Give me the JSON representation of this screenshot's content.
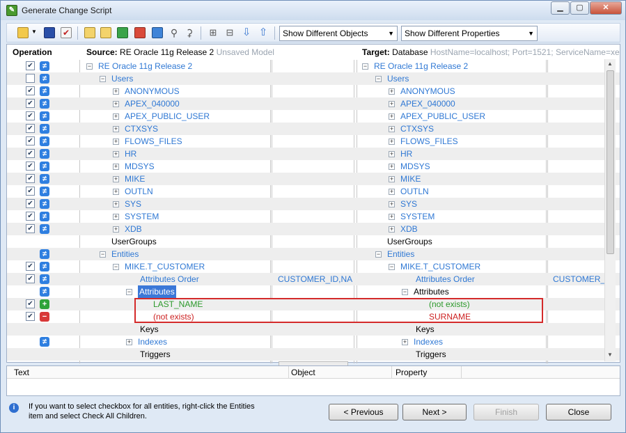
{
  "window": {
    "title": "Generate Change Script",
    "controls": [
      "▁",
      "▢",
      "✕"
    ]
  },
  "toolbar": {
    "filter_objects": "Show Different Objects",
    "filter_properties": "Show Different Properties"
  },
  "headers": {
    "operation": "Operation",
    "source_label": "Source:",
    "source_name": "RE Oracle 11g Release 2",
    "source_note": "Unsaved Model",
    "target_label": "Target:",
    "target_name": "Database",
    "target_note": "HostName=localhost; Port=1521; ServiceName=xe; UserId"
  },
  "rows": [
    {
      "check": true,
      "op": "ne",
      "src": "RE Oracle 11g Release 2",
      "tgt": "RE Oracle 11g Release 2",
      "level": 0,
      "exp": "−",
      "src_color": "blue",
      "tgt_color": "blue",
      "src_val": "",
      "tgt_val": ""
    },
    {
      "check": false,
      "op": "ne",
      "src": "Users",
      "tgt": "Users",
      "level": 1,
      "exp": "−",
      "src_color": "blue",
      "tgt_color": "blue",
      "src_val": "",
      "tgt_val": ""
    },
    {
      "check": true,
      "op": "ne",
      "src": "ANONYMOUS",
      "tgt": "ANONYMOUS",
      "level": 2,
      "exp": "+",
      "src_color": "blue",
      "tgt_color": "blue",
      "src_val": "",
      "tgt_val": ""
    },
    {
      "check": true,
      "op": "ne",
      "src": "APEX_040000",
      "tgt": "APEX_040000",
      "level": 2,
      "exp": "+",
      "src_color": "blue",
      "tgt_color": "blue",
      "src_val": "",
      "tgt_val": ""
    },
    {
      "check": true,
      "op": "ne",
      "src": "APEX_PUBLIC_USER",
      "tgt": "APEX_PUBLIC_USER",
      "level": 2,
      "exp": "+",
      "src_color": "blue",
      "tgt_color": "blue",
      "src_val": "",
      "tgt_val": ""
    },
    {
      "check": true,
      "op": "ne",
      "src": "CTXSYS",
      "tgt": "CTXSYS",
      "level": 2,
      "exp": "+",
      "src_color": "blue",
      "tgt_color": "blue",
      "src_val": "",
      "tgt_val": ""
    },
    {
      "check": true,
      "op": "ne",
      "src": "FLOWS_FILES",
      "tgt": "FLOWS_FILES",
      "level": 2,
      "exp": "+",
      "src_color": "blue",
      "tgt_color": "blue",
      "src_val": "",
      "tgt_val": ""
    },
    {
      "check": true,
      "op": "ne",
      "src": "HR",
      "tgt": "HR",
      "level": 2,
      "exp": "+",
      "src_color": "blue",
      "tgt_color": "blue",
      "src_val": "",
      "tgt_val": ""
    },
    {
      "check": true,
      "op": "ne",
      "src": "MDSYS",
      "tgt": "MDSYS",
      "level": 2,
      "exp": "+",
      "src_color": "blue",
      "tgt_color": "blue",
      "src_val": "",
      "tgt_val": ""
    },
    {
      "check": true,
      "op": "ne",
      "src": "MIKE",
      "tgt": "MIKE",
      "level": 2,
      "exp": "+",
      "src_color": "blue",
      "tgt_color": "blue",
      "src_val": "",
      "tgt_val": ""
    },
    {
      "check": true,
      "op": "ne",
      "src": "OUTLN",
      "tgt": "OUTLN",
      "level": 2,
      "exp": "+",
      "src_color": "blue",
      "tgt_color": "blue",
      "src_val": "",
      "tgt_val": ""
    },
    {
      "check": true,
      "op": "ne",
      "src": "SYS",
      "tgt": "SYS",
      "level": 2,
      "exp": "+",
      "src_color": "blue",
      "tgt_color": "blue",
      "src_val": "",
      "tgt_val": ""
    },
    {
      "check": true,
      "op": "ne",
      "src": "SYSTEM",
      "tgt": "SYSTEM",
      "level": 2,
      "exp": "+",
      "src_color": "blue",
      "tgt_color": "blue",
      "src_val": "",
      "tgt_val": ""
    },
    {
      "check": true,
      "op": "ne",
      "src": "XDB",
      "tgt": "XDB",
      "level": 2,
      "exp": "+",
      "src_color": "blue",
      "tgt_color": "blue",
      "src_val": "",
      "tgt_val": ""
    },
    {
      "check": null,
      "op": "",
      "src": "UserGroups",
      "tgt": "UserGroups",
      "level": 1,
      "exp": "",
      "src_color": "black",
      "tgt_color": "black",
      "src_val": "",
      "tgt_val": ""
    },
    {
      "check": null,
      "op": "ne",
      "src": "Entities",
      "tgt": "Entities",
      "level": 1,
      "exp": "−",
      "src_color": "blue",
      "tgt_color": "blue",
      "src_val": "",
      "tgt_val": ""
    },
    {
      "check": true,
      "op": "ne",
      "src": "MIKE.T_CUSTOMER",
      "tgt": "MIKE.T_CUSTOMER",
      "level": 2,
      "exp": "−",
      "src_color": "blue",
      "tgt_color": "blue",
      "src_val": "",
      "tgt_val": ""
    },
    {
      "check": true,
      "op": "ne",
      "src": "Attributes Order",
      "tgt": "Attributes Order",
      "level": 3,
      "exp": "",
      "src_color": "blue",
      "tgt_color": "blue",
      "src_val": "CUSTOMER_ID,NA...",
      "tgt_val": "CUSTOMER_ID"
    },
    {
      "check": null,
      "op": "ne",
      "src": "Attributes",
      "tgt": "Attributes",
      "level": 3,
      "exp": "−",
      "src_color": "selected",
      "tgt_color": "black",
      "src_val": "",
      "tgt_val": ""
    },
    {
      "check": true,
      "op": "add",
      "src": "LAST_NAME",
      "tgt": "(not exists)",
      "level": 4,
      "exp": "",
      "src_color": "green",
      "tgt_color": "green",
      "src_val": "",
      "tgt_val": ""
    },
    {
      "check": true,
      "op": "del",
      "src": "(not exists)",
      "tgt": "SURNAME",
      "level": 4,
      "exp": "",
      "src_color": "red",
      "tgt_color": "red",
      "src_val": "",
      "tgt_val": ""
    },
    {
      "check": null,
      "op": "",
      "src": "Keys",
      "tgt": "Keys",
      "level": 3,
      "exp": "",
      "src_color": "black",
      "tgt_color": "black",
      "src_val": "",
      "tgt_val": ""
    },
    {
      "check": null,
      "op": "ne",
      "src": "Indexes",
      "tgt": "Indexes",
      "level": 3,
      "exp": "+",
      "src_color": "blue",
      "tgt_color": "blue",
      "src_val": "",
      "tgt_val": ""
    },
    {
      "check": null,
      "op": "",
      "src": "Triggers",
      "tgt": "Triggers",
      "level": 3,
      "exp": "",
      "src_color": "black",
      "tgt_color": "black",
      "src_val": "",
      "tgt_val": ""
    }
  ],
  "lower": {
    "col_text": "Text",
    "col_object": "Object",
    "col_property": "Property"
  },
  "footer": {
    "hint": "If you want to select checkbox for all entities, right-click the Entities item and select Check All Children.",
    "prev": "< Previous",
    "next": "Next >",
    "finish": "Finish",
    "close": "Close"
  }
}
